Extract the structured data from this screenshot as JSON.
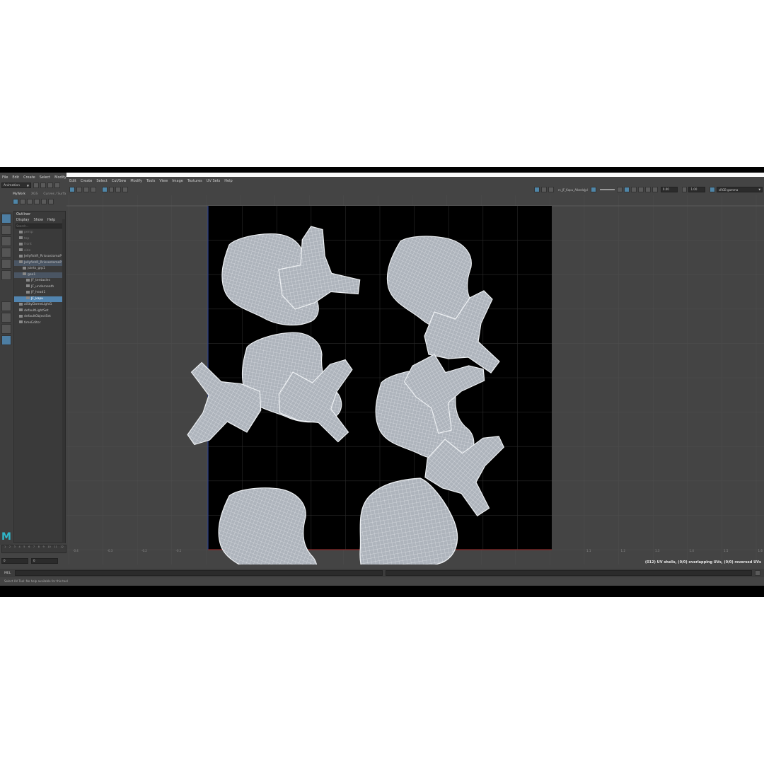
{
  "main_menu": [
    "File",
    "Edit",
    "Create",
    "Select",
    "Modify"
  ],
  "mode_selector": "Animation",
  "shelf_tabs": [
    "MyWork",
    "XGS",
    "Curves / Surfa"
  ],
  "outliner": {
    "title": "Outliner",
    "menu": [
      "Display",
      "Show",
      "Help"
    ],
    "search_placeholder": "Search...",
    "items": [
      {
        "label": "persp",
        "indent": 1,
        "state": "dim"
      },
      {
        "label": "top",
        "indent": 1,
        "state": "dim"
      },
      {
        "label": "front",
        "indent": 1,
        "state": "dim"
      },
      {
        "label": "side",
        "indent": 1,
        "state": "dim"
      },
      {
        "label": "JellyfishR_RrissostomaP",
        "indent": 1,
        "state": "normal"
      },
      {
        "label": "JellyfishR_RrissostomaP",
        "indent": 1,
        "state": "highlight"
      },
      {
        "label": "joints_grp1",
        "indent": 2,
        "state": "normal"
      },
      {
        "label": "geo1",
        "indent": 2,
        "state": "highlight"
      },
      {
        "label": "JF_tentacles",
        "indent": 3,
        "state": "normal"
      },
      {
        "label": "JF_underneath",
        "indent": 3,
        "state": "normal"
      },
      {
        "label": "JF_head1",
        "indent": 3,
        "state": "normal"
      },
      {
        "label": "JF_kapu",
        "indent": 3,
        "state": "selected"
      },
      {
        "label": "aiSkyDomeLight1",
        "indent": 1,
        "state": "normal"
      },
      {
        "label": "defaultLightSet",
        "indent": 1,
        "state": "normal"
      },
      {
        "label": "defaultObjectSet",
        "indent": 1,
        "state": "normal"
      },
      {
        "label": "timeEditor",
        "indent": 1,
        "state": "normal"
      }
    ]
  },
  "uv_editor": {
    "menu": [
      "Edit",
      "Create",
      "Select",
      "Cut/Sew",
      "Modify",
      "Tools",
      "View",
      "Image",
      "Textures",
      "UV Sets",
      "Help"
    ],
    "texture_name": "rs_JF_Kapu_AlbedoJpl",
    "exposure_value": "0.00",
    "gamma_value": "1.00",
    "color_space": "sRGB gamma",
    "status": "(012) UV shells, (0/0) overlapping UVs, (0/0) reversed UVs"
  },
  "axis_ticks_left": [
    "-0.4",
    "-0.3",
    "-0.2",
    "-0.1"
  ],
  "axis_ticks_right": [
    "1.1",
    "1.2",
    "1.3",
    "1.4",
    "1.5",
    "1.6"
  ],
  "timeline_ticks": [
    "1",
    "2",
    "3",
    "4",
    "5",
    "6",
    "7",
    "8",
    "9",
    "10",
    "11",
    "12"
  ],
  "range_fields": [
    "0",
    "0"
  ],
  "command_line_label": "MEL",
  "help_line": "Select UV Tool: No help available for this tool",
  "colors": {
    "app_bg": "#444444",
    "uv_shell_fill": "#aeb4bc",
    "uv_wire": "#eef1f4",
    "uv_space": "#000000",
    "selection_blue": "#5285b0"
  }
}
